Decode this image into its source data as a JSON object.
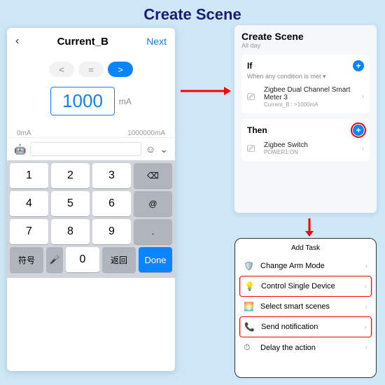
{
  "title": "Create Scene",
  "left": {
    "back": "‹",
    "title": "Current_B",
    "next": "Next",
    "ops": {
      "lt": "<",
      "eq": "=",
      "gt": ">"
    },
    "value": "1000",
    "unit": "mA",
    "range_min": "0mA",
    "range_max": "1000000mA",
    "emoji_btn": "☺",
    "robot_btn": "🤖",
    "chev": "⌄",
    "keys": {
      "r1": [
        "1",
        "2",
        "3",
        "⌫"
      ],
      "r2": [
        "4",
        "5",
        "6",
        "@"
      ],
      "r3": [
        "7",
        "8",
        "9",
        "."
      ],
      "r4": [
        "符号",
        "0",
        "返回",
        "Done"
      ],
      "extra": "🎤"
    }
  },
  "scene": {
    "heading": "Create Scene",
    "subtitle": "All day",
    "if_label": "If",
    "if_sub": "When any condition is met ▾",
    "if_item_name": "Zigbee Dual Channel Smart Meter 3",
    "if_item_sub": "Current_B : >1000mA",
    "then_label": "Then",
    "then_item_name": "Zigbee Switch",
    "then_item_sub": "POWER1:ON",
    "plus": "+",
    "chev": "›",
    "dev_icon": "⎚"
  },
  "task": {
    "title": "Add Task",
    "rows": [
      {
        "icon": "🛡️",
        "label": "Change Arm Mode",
        "hl": false,
        "color": "#7b4dff"
      },
      {
        "icon": "💡",
        "label": "Control Single Device",
        "hl": true,
        "color": "#ffb300"
      },
      {
        "icon": "🌅",
        "label": "Select smart scenes",
        "hl": false,
        "color": "#ff6b4a"
      },
      {
        "icon": "📞",
        "label": "Send notification",
        "hl": true,
        "color": "#22c38a"
      },
      {
        "icon": "⏱",
        "label": "Delay the action",
        "hl": false,
        "color": "#555"
      }
    ],
    "chev": "›"
  }
}
